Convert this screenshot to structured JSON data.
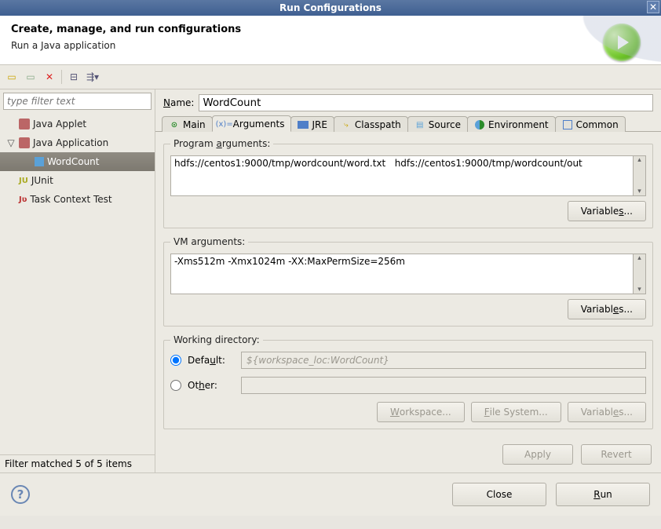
{
  "title": "Run Configurations",
  "header": {
    "heading": "Create, manage, and run configurations",
    "sub": "Run a Java application"
  },
  "filter_placeholder": "type filter text",
  "tree": {
    "items": [
      {
        "label": "Java Applet"
      },
      {
        "label": "Java Application",
        "expanded": true,
        "children": [
          {
            "label": "WordCount",
            "selected": true
          }
        ]
      },
      {
        "label": "JUnit"
      },
      {
        "label": "Task Context Test"
      }
    ]
  },
  "status_left": "Filter matched 5 of 5 items",
  "name_label": "Name:",
  "name_value": "WordCount",
  "tabs": {
    "main": "Main",
    "arguments": "Arguments",
    "jre": "JRE",
    "classpath": "Classpath",
    "source": "Source",
    "environment": "Environment",
    "common": "Common"
  },
  "program_args": {
    "legend": "Program arguments:",
    "value": "hdfs://centos1:9000/tmp/wordcount/word.txt   hdfs://centos1:9000/tmp/wordcount/out",
    "variables_btn": "Variables..."
  },
  "vm_args": {
    "legend": "VM arguments:",
    "value": "-Xms512m -Xmx1024m -XX:MaxPermSize=256m",
    "variables_btn": "Variables..."
  },
  "working_dir": {
    "legend": "Working directory:",
    "default_label": "Default:",
    "default_value": "${workspace_loc:WordCount}",
    "other_label": "Other:",
    "workspace_btn": "Workspace...",
    "filesystem_btn": "File System...",
    "variables_btn": "Variables..."
  },
  "apply_btn": "Apply",
  "revert_btn": "Revert",
  "close_btn": "Close",
  "run_btn": "Run"
}
